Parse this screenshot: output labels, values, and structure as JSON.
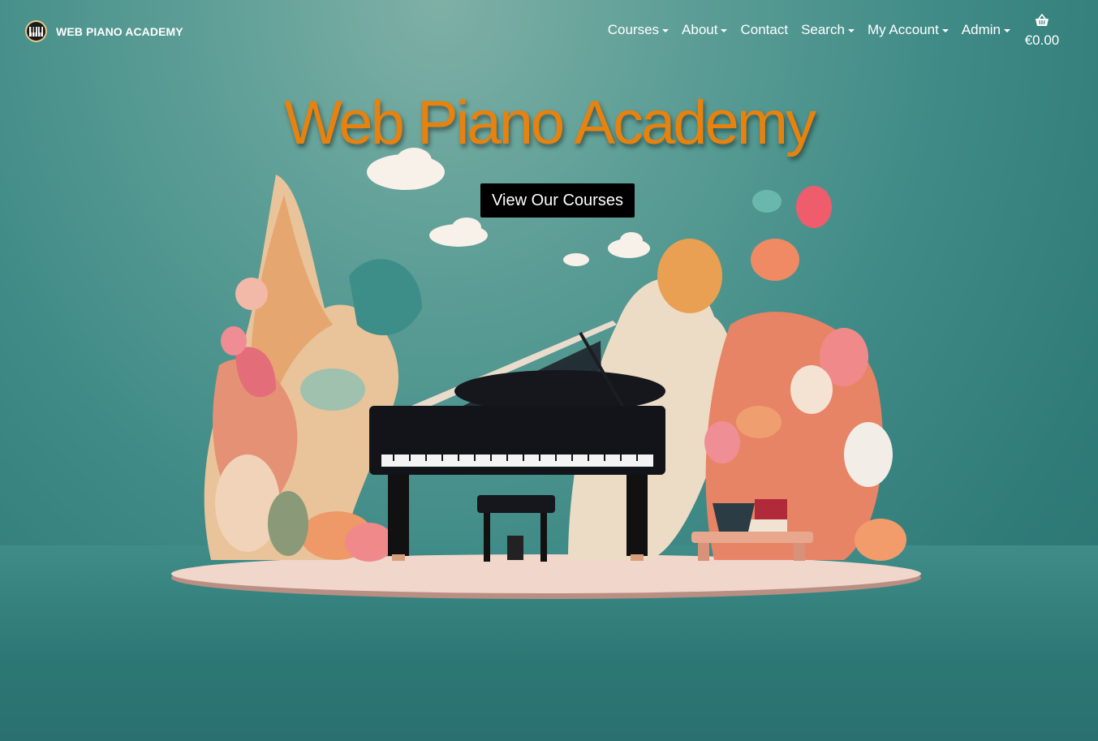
{
  "brand": {
    "name": "WEB PIANO ACADEMY",
    "logo_icon": "piano-keys-icon"
  },
  "nav": {
    "items": [
      {
        "label": "Courses",
        "dropdown": true
      },
      {
        "label": "About",
        "dropdown": true
      },
      {
        "label": "Contact",
        "dropdown": false
      },
      {
        "label": "Search",
        "dropdown": true
      },
      {
        "label": "My Account",
        "dropdown": true
      },
      {
        "label": "Admin",
        "dropdown": true
      }
    ]
  },
  "cart": {
    "icon": "basket-icon",
    "total": "€0.00"
  },
  "hero": {
    "title": "Web Piano Academy",
    "cta_label": "View Our Courses",
    "title_color": "#e8820e",
    "background_color": "#3f8a86"
  }
}
